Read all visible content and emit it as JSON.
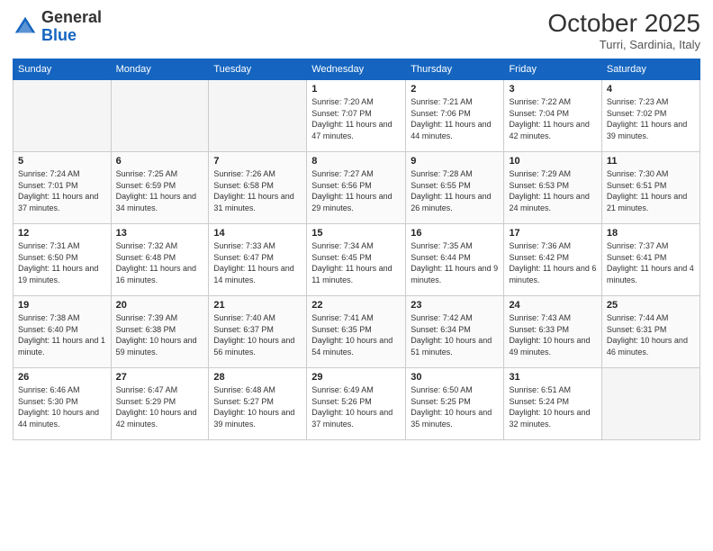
{
  "header": {
    "logo_line1": "General",
    "logo_line2": "Blue",
    "month": "October 2025",
    "location": "Turri, Sardinia, Italy"
  },
  "days_of_week": [
    "Sunday",
    "Monday",
    "Tuesday",
    "Wednesday",
    "Thursday",
    "Friday",
    "Saturday"
  ],
  "weeks": [
    [
      {
        "day": "",
        "empty": true
      },
      {
        "day": "",
        "empty": true
      },
      {
        "day": "",
        "empty": true
      },
      {
        "day": "1",
        "sunrise": "7:20 AM",
        "sunset": "7:07 PM",
        "daylight": "11 hours and 47 minutes."
      },
      {
        "day": "2",
        "sunrise": "7:21 AM",
        "sunset": "7:06 PM",
        "daylight": "11 hours and 44 minutes."
      },
      {
        "day": "3",
        "sunrise": "7:22 AM",
        "sunset": "7:04 PM",
        "daylight": "11 hours and 42 minutes."
      },
      {
        "day": "4",
        "sunrise": "7:23 AM",
        "sunset": "7:02 PM",
        "daylight": "11 hours and 39 minutes."
      }
    ],
    [
      {
        "day": "5",
        "sunrise": "7:24 AM",
        "sunset": "7:01 PM",
        "daylight": "11 hours and 37 minutes."
      },
      {
        "day": "6",
        "sunrise": "7:25 AM",
        "sunset": "6:59 PM",
        "daylight": "11 hours and 34 minutes."
      },
      {
        "day": "7",
        "sunrise": "7:26 AM",
        "sunset": "6:58 PM",
        "daylight": "11 hours and 31 minutes."
      },
      {
        "day": "8",
        "sunrise": "7:27 AM",
        "sunset": "6:56 PM",
        "daylight": "11 hours and 29 minutes."
      },
      {
        "day": "9",
        "sunrise": "7:28 AM",
        "sunset": "6:55 PM",
        "daylight": "11 hours and 26 minutes."
      },
      {
        "day": "10",
        "sunrise": "7:29 AM",
        "sunset": "6:53 PM",
        "daylight": "11 hours and 24 minutes."
      },
      {
        "day": "11",
        "sunrise": "7:30 AM",
        "sunset": "6:51 PM",
        "daylight": "11 hours and 21 minutes."
      }
    ],
    [
      {
        "day": "12",
        "sunrise": "7:31 AM",
        "sunset": "6:50 PM",
        "daylight": "11 hours and 19 minutes."
      },
      {
        "day": "13",
        "sunrise": "7:32 AM",
        "sunset": "6:48 PM",
        "daylight": "11 hours and 16 minutes."
      },
      {
        "day": "14",
        "sunrise": "7:33 AM",
        "sunset": "6:47 PM",
        "daylight": "11 hours and 14 minutes."
      },
      {
        "day": "15",
        "sunrise": "7:34 AM",
        "sunset": "6:45 PM",
        "daylight": "11 hours and 11 minutes."
      },
      {
        "day": "16",
        "sunrise": "7:35 AM",
        "sunset": "6:44 PM",
        "daylight": "11 hours and 9 minutes."
      },
      {
        "day": "17",
        "sunrise": "7:36 AM",
        "sunset": "6:42 PM",
        "daylight": "11 hours and 6 minutes."
      },
      {
        "day": "18",
        "sunrise": "7:37 AM",
        "sunset": "6:41 PM",
        "daylight": "11 hours and 4 minutes."
      }
    ],
    [
      {
        "day": "19",
        "sunrise": "7:38 AM",
        "sunset": "6:40 PM",
        "daylight": "11 hours and 1 minute."
      },
      {
        "day": "20",
        "sunrise": "7:39 AM",
        "sunset": "6:38 PM",
        "daylight": "10 hours and 59 minutes."
      },
      {
        "day": "21",
        "sunrise": "7:40 AM",
        "sunset": "6:37 PM",
        "daylight": "10 hours and 56 minutes."
      },
      {
        "day": "22",
        "sunrise": "7:41 AM",
        "sunset": "6:35 PM",
        "daylight": "10 hours and 54 minutes."
      },
      {
        "day": "23",
        "sunrise": "7:42 AM",
        "sunset": "6:34 PM",
        "daylight": "10 hours and 51 minutes."
      },
      {
        "day": "24",
        "sunrise": "7:43 AM",
        "sunset": "6:33 PM",
        "daylight": "10 hours and 49 minutes."
      },
      {
        "day": "25",
        "sunrise": "7:44 AM",
        "sunset": "6:31 PM",
        "daylight": "10 hours and 46 minutes."
      }
    ],
    [
      {
        "day": "26",
        "sunrise": "6:46 AM",
        "sunset": "5:30 PM",
        "daylight": "10 hours and 44 minutes."
      },
      {
        "day": "27",
        "sunrise": "6:47 AM",
        "sunset": "5:29 PM",
        "daylight": "10 hours and 42 minutes."
      },
      {
        "day": "28",
        "sunrise": "6:48 AM",
        "sunset": "5:27 PM",
        "daylight": "10 hours and 39 minutes."
      },
      {
        "day": "29",
        "sunrise": "6:49 AM",
        "sunset": "5:26 PM",
        "daylight": "10 hours and 37 minutes."
      },
      {
        "day": "30",
        "sunrise": "6:50 AM",
        "sunset": "5:25 PM",
        "daylight": "10 hours and 35 minutes."
      },
      {
        "day": "31",
        "sunrise": "6:51 AM",
        "sunset": "5:24 PM",
        "daylight": "10 hours and 32 minutes."
      },
      {
        "day": "",
        "empty": true
      }
    ]
  ]
}
